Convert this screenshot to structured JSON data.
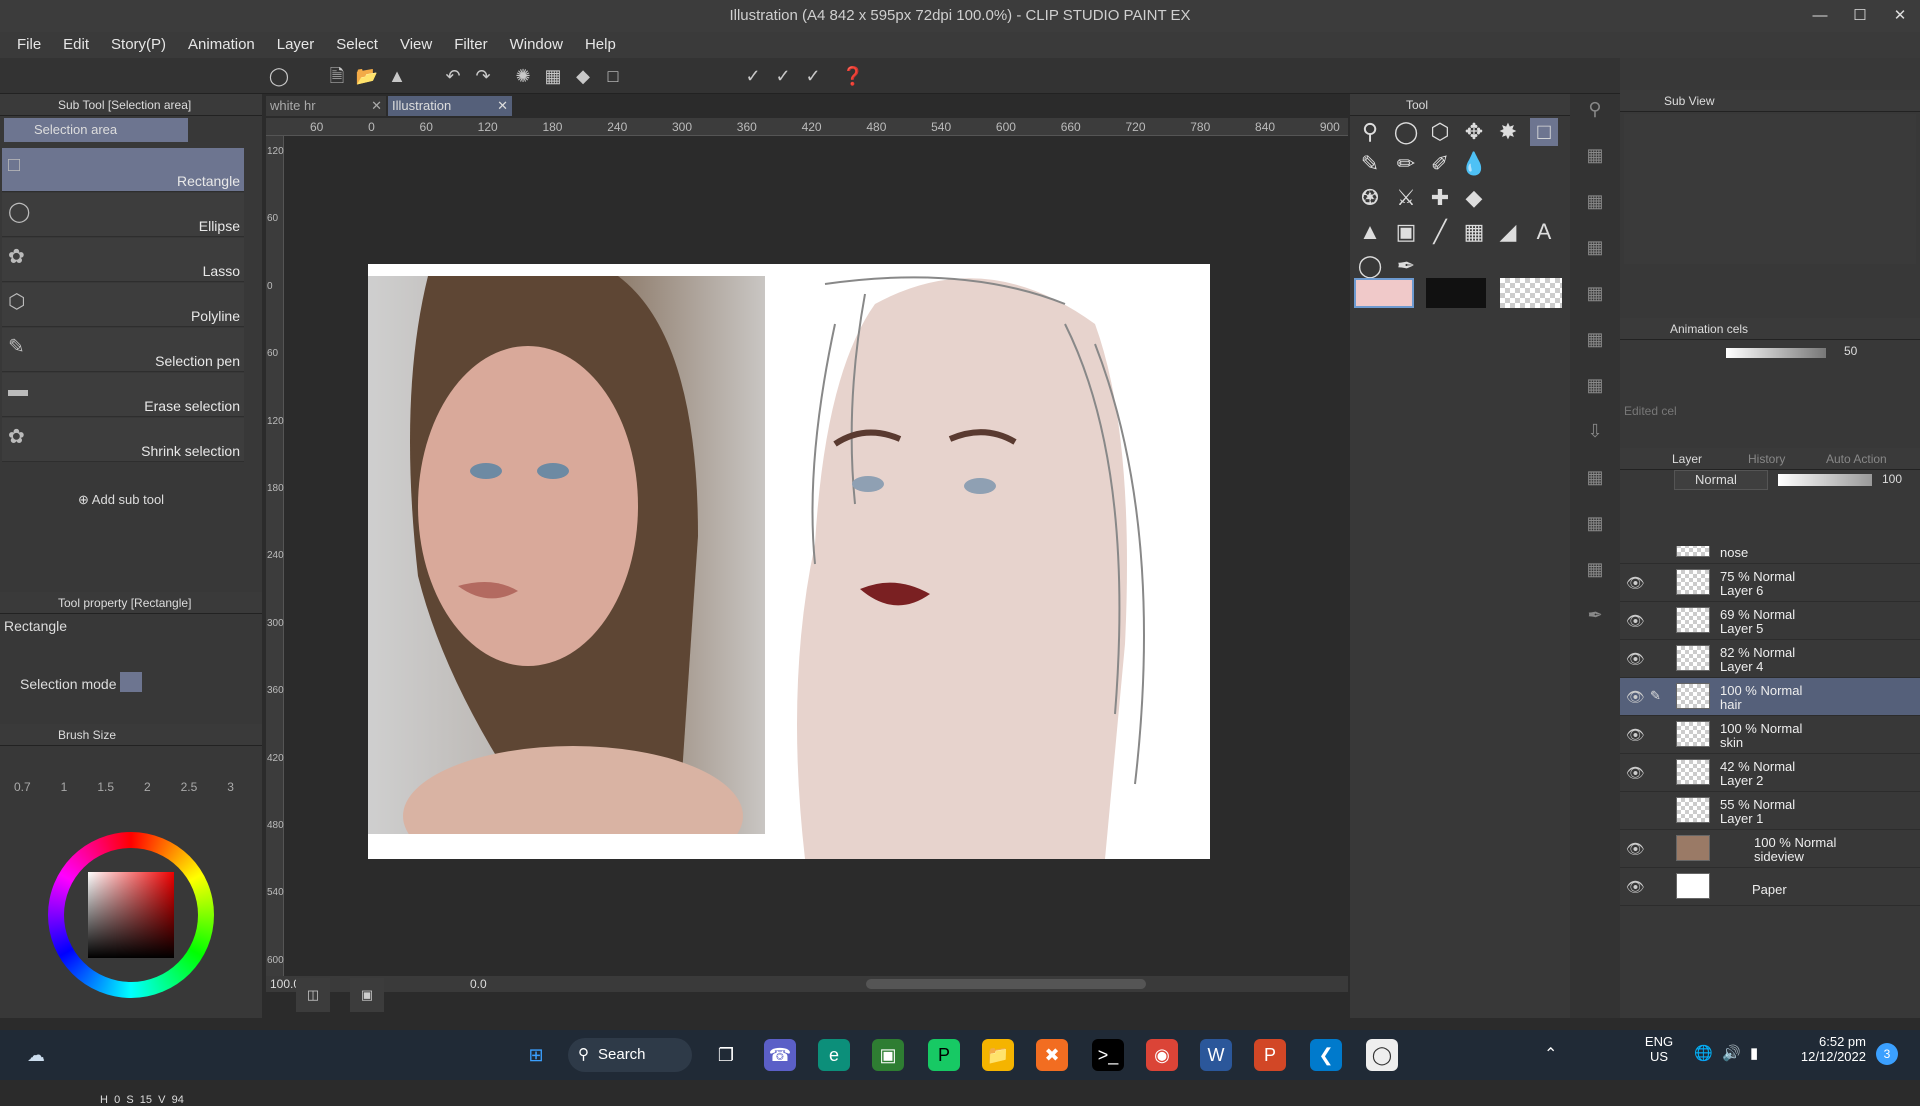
{
  "window": {
    "title": "Illustration (A4 842 x 595px 72dpi 100.0%)  - CLIP STUDIO PAINT EX"
  },
  "menu": [
    "File",
    "Edit",
    "Story(P)",
    "Animation",
    "Layer",
    "Select",
    "View",
    "Filter",
    "Window",
    "Help"
  ],
  "sub_tool": {
    "header": "Sub Tool [Selection area]",
    "group": "Selection area",
    "items": [
      "Rectangle",
      "Ellipse",
      "Lasso",
      "Polyline",
      "Selection pen",
      "Erase selection",
      "Shrink selection"
    ],
    "add": "Add sub tool"
  },
  "tool_property": {
    "header": "Tool property [Rectangle]",
    "name": "Rectangle",
    "selection_mode": "Selection mode"
  },
  "brush_size": {
    "header": "Brush Size",
    "values": [
      "0.7",
      "1",
      "1.5",
      "2",
      "2.5",
      "3"
    ]
  },
  "color": {
    "h": "H",
    "h_val": "0",
    "s": "S",
    "s_val": "15",
    "v": "V",
    "v_val": "94",
    "main": "#f0c9c9"
  },
  "tabs": [
    {
      "label": "white hr"
    },
    {
      "label": "Illustration"
    }
  ],
  "ruler_top": [
    "60",
    "0",
    "60",
    "120",
    "180",
    "240",
    "300",
    "360",
    "420",
    "480",
    "540",
    "600",
    "660",
    "720",
    "780",
    "840",
    "900"
  ],
  "ruler_left": [
    "120",
    "60",
    "0",
    "60",
    "120",
    "180",
    "240",
    "300",
    "360",
    "420",
    "480",
    "540",
    "600"
  ],
  "canvas_status": {
    "zoom": "100.0",
    "angle": "0.0"
  },
  "tool_panel": {
    "header": "Tool"
  },
  "sub_view": {
    "header": "Sub View"
  },
  "animation_cels": {
    "header": "Animation cels",
    "opacity": "50",
    "edited": "Edited cel"
  },
  "layer_panel": {
    "tabs": [
      "Layer",
      "History",
      "Auto Action"
    ],
    "blend": "Normal",
    "opacity": "100",
    "layers": [
      {
        "line1": "nose",
        "line2": ""
      },
      {
        "line1": "75 % Normal",
        "line2": "Layer 6"
      },
      {
        "line1": "69 % Normal",
        "line2": "Layer 5"
      },
      {
        "line1": "82 % Normal",
        "line2": "Layer 4"
      },
      {
        "line1": "100 % Normal",
        "line2": "hair"
      },
      {
        "line1": "100 % Normal",
        "line2": "skin"
      },
      {
        "line1": "42 % Normal",
        "line2": "Layer 2"
      },
      {
        "line1": "55 % Normal",
        "line2": "Layer 1"
      },
      {
        "line1": "100 % Normal",
        "line2": "sideview"
      },
      {
        "line1": "Paper",
        "line2": ""
      }
    ]
  },
  "taskbar": {
    "search": "Search",
    "lang1": "ENG",
    "lang2": "US",
    "time": "6:52 pm",
    "date": "12/12/2022",
    "badge": "3"
  }
}
